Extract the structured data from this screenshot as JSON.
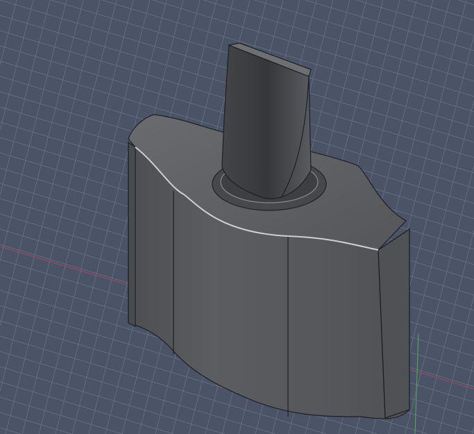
{
  "viewport": {
    "background": "#4b5467",
    "grid_color": "#6b7488",
    "x_axis_color": "#b04a5a",
    "y_axis_color": "#4caf50",
    "model_color": "#5a5b5e",
    "edge_color": "#1e1f22"
  }
}
